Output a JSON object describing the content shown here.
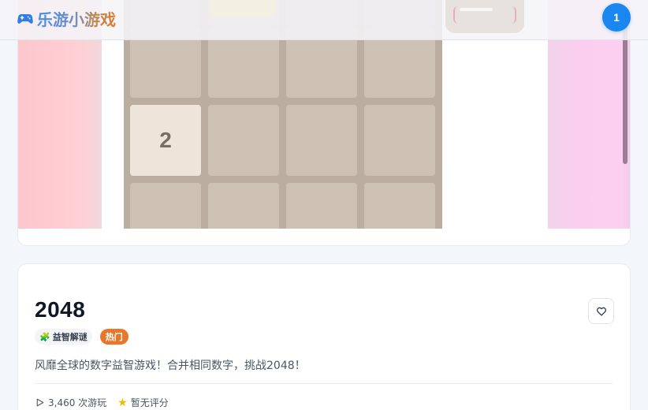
{
  "header": {
    "logo_text": "乐游小游戏",
    "logo_icon": "gamepad-icon",
    "user_avatar_label": "1",
    "brand_color": "#1a86f0"
  },
  "preview": {
    "board_colors": {
      "background": "#bbada0",
      "empty_tile": "#cdc1b4",
      "tile_2": "#eee4da",
      "tile_text": "#776e65"
    },
    "visible_tiles": [
      [
        "",
        "",
        "",
        ""
      ],
      [
        "2",
        "",
        "",
        ""
      ],
      [
        "",
        "",
        "",
        ""
      ]
    ]
  },
  "game": {
    "title": "2048",
    "category_icon": "puzzle-icon",
    "category": "益智解谜",
    "hot_badge": "热门",
    "description": "风靡全球的数字益智游戏！合并相同数字，挑战2048！",
    "favorite_icon": "heart-icon",
    "play_icon": "play-icon",
    "play_count": "3,460 次游玩",
    "rating_icon": "star-icon",
    "rating": "暂无评分",
    "accent_color": "#e8772a"
  }
}
